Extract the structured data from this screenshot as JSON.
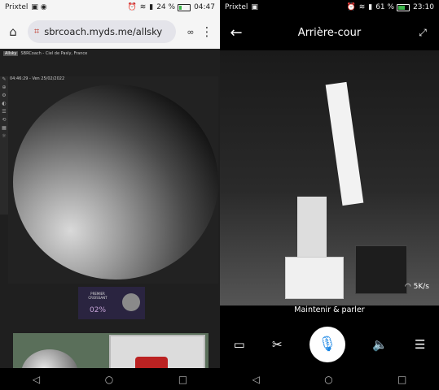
{
  "left": {
    "status": {
      "app": "Prixtel",
      "battery": "24 %",
      "time": "04:47"
    },
    "browser": {
      "url": "sbrcoach.myds.me/allsky"
    },
    "allsky": {
      "tag": "Allsky",
      "site": "SBRCoach - Ciel de Pasly, France",
      "timestamp": "04:46:29 - Ven 25/02/2022",
      "moon_label": "PREMIER CROISSANT",
      "moon_percent": "02%"
    }
  },
  "right": {
    "status": {
      "app": "Prixtel",
      "battery": "61 %",
      "time": "23:10"
    },
    "app": {
      "title": "Arrière-cour",
      "rate": "5K/s",
      "hold_to_talk": "Maintenir & parler"
    }
  }
}
